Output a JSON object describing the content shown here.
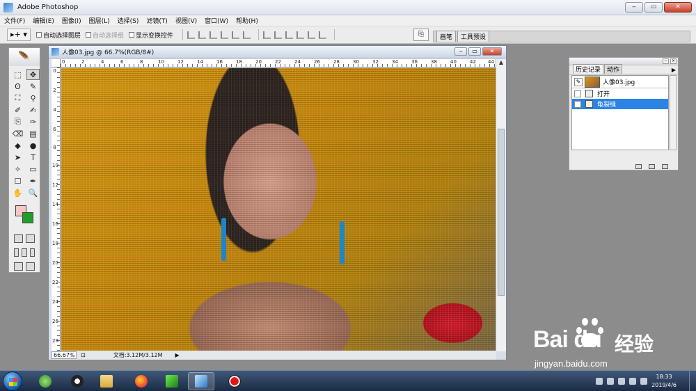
{
  "app": {
    "title": "Adobe Photoshop",
    "window_buttons": [
      "‒",
      "▭",
      "✕"
    ]
  },
  "menu": [
    "文件(F)",
    "编辑(E)",
    "图像(I)",
    "图层(L)",
    "选择(S)",
    "滤镜(T)",
    "视图(V)",
    "窗口(W)",
    "帮助(H)"
  ],
  "options": {
    "tool_preset": "▸+ ▾",
    "auto_select_layer": "自动选择图层",
    "auto_select_group": "自动选择组",
    "show_transform": "显示变换控件",
    "well_tabs": [
      "画笔",
      "工具预设"
    ]
  },
  "toolbox": {
    "tools": [
      "⬚",
      "✥",
      "ʘ",
      "✎",
      "⛶",
      "⚲",
      "✐",
      "✍",
      "⎘",
      "✑",
      "⌫",
      "▤",
      "◆",
      "●",
      "➤",
      "T",
      "✧",
      "▭",
      "☐",
      "✒",
      "✋",
      "🔍"
    ]
  },
  "document": {
    "title": "人像03.jpg @ 66.7%(RGB/8#)",
    "ruler_h": [
      "0",
      "2",
      "4",
      "6",
      "8",
      "10",
      "12",
      "14",
      "16",
      "18",
      "20",
      "22",
      "24",
      "26",
      "28",
      "30",
      "32",
      "34",
      "36",
      "38",
      "40",
      "42",
      "44"
    ],
    "ruler_v": [
      "0",
      "2",
      "4",
      "6",
      "8",
      "10",
      "12",
      "14",
      "16",
      "18",
      "20",
      "22",
      "24",
      "26",
      "28"
    ],
    "zoom": "66.67%",
    "doc_size": "文档:3.12M/3.12M"
  },
  "history": {
    "tabs": [
      "历史记录",
      "动作"
    ],
    "snapshot": "人像03.jpg",
    "steps": [
      {
        "label": "打开",
        "selected": false
      },
      {
        "label": "龟裂缝",
        "selected": true
      }
    ]
  },
  "taskbar": {
    "time": "18:33",
    "date": "2019/4/6"
  },
  "watermark": {
    "brand": "Bai  du",
    "brand_cn": "经验",
    "url": "jingyan.baidu.com"
  }
}
